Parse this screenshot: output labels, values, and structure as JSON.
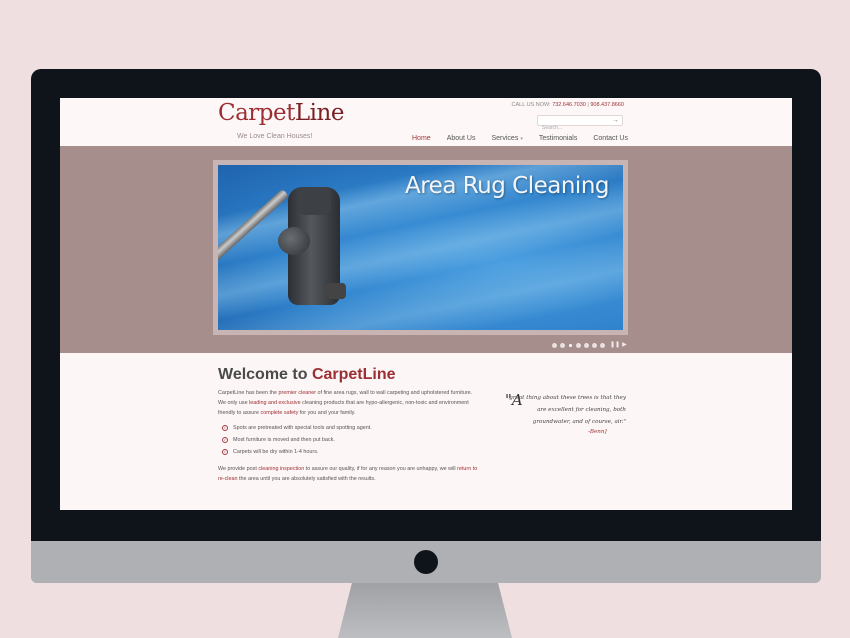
{
  "header": {
    "logo_part1": "Carpet",
    "logo_part2": "Line",
    "tagline": "We Love Clean Houses!",
    "call_label": "CALL US NOW: ",
    "phone1": "732.646.7030",
    "phone_separator": " | ",
    "phone2": "908.437.8660",
    "search_placeholder": "Search..."
  },
  "nav": {
    "items": [
      {
        "label": "Home",
        "active": true
      },
      {
        "label": "About Us"
      },
      {
        "label": "Services"
      },
      {
        "label": "Testimonials"
      },
      {
        "label": "Contact Us"
      }
    ]
  },
  "slider": {
    "caption": "Area Rug Cleaning",
    "slide_count": 7,
    "active_index": 2,
    "pause_label": "❚❚",
    "next_label": "▶"
  },
  "main": {
    "welcome_prefix": "Welcome to ",
    "welcome_brand": "CarpetLine",
    "intro_1": "CarpetLine has been the ",
    "intro_link1": "premier cleaner",
    "intro_2": " of fine area rugs, wall to wall carpeting and upholstered furniture. We only use ",
    "intro_link2": "leading and exclusive",
    "intro_3": " cleaning products that are hypo-allergenic, non-toxic and environment friendly to assure ",
    "intro_link3": "complete safety",
    "intro_4": " for you and your family.",
    "bullets": [
      "Spots are pretreated with special tools and spotting agent.",
      "Most furniture is moved and then put back.",
      "Carpets will be dry within 1-4 hours."
    ],
    "outro_1": "We provide post ",
    "outro_link1": "cleaning inspection",
    "outro_2": " to assure our quality, if for any reason you are unhappy, we will ",
    "outro_link2": "return to re-clean",
    "outro_3": " the area until you are absolutely satisfied with the results."
  },
  "testimonial": {
    "open_quote": "\"A",
    "text": "great thing about these trees is that they are excellent for cleaning, both groundwater, and of course, air.\"",
    "author": "-Benn]"
  },
  "colors": {
    "brand": "#9c2f34",
    "slider_band": "#a58e8c",
    "bezel": "#0f131a"
  }
}
